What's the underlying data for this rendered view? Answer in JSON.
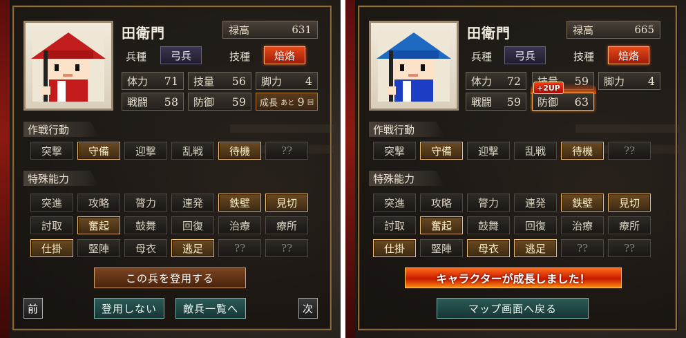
{
  "colors": {
    "frame": "#8a6a3a",
    "active_button": "#f0c070",
    "teal_button": "#2c5a56",
    "fire": "#e24a1a"
  },
  "left": {
    "name": "田衛門",
    "stipend": {
      "label": "禄高",
      "value": "631"
    },
    "unit_type": {
      "label": "兵種",
      "value": "弓兵"
    },
    "skill": {
      "label": "技種",
      "value": "焙烙"
    },
    "stats": {
      "hp": {
        "label": "体力",
        "value": "71"
      },
      "tech": {
        "label": "技量",
        "value": "56"
      },
      "legs": {
        "label": "脚力",
        "value": "4"
      },
      "combat": {
        "label": "戦闘",
        "value": "58"
      },
      "defense": {
        "label": "防御",
        "value": "59"
      }
    },
    "growth": {
      "label": "成長",
      "prefix": "あと",
      "value": "9",
      "suffix": "回"
    },
    "tactics_title": "作戦行動",
    "tactics": [
      "突撃",
      "守備",
      "迎撃",
      "乱戦",
      "待機",
      "??"
    ],
    "abilities_title": "特殊能力",
    "abilities": [
      "突進",
      "攻略",
      "膂力",
      "連発",
      "鉄壁",
      "見切",
      "討取",
      "奮起",
      "鼓舞",
      "回復",
      "治療",
      "療所",
      "仕掛",
      "堅陣",
      "母衣",
      "逃足",
      "??",
      "??"
    ],
    "recruit_button": "この兵を登用する",
    "skip_button": "登用しない",
    "enemy_list_button": "敵兵一覧へ",
    "prev_button": "前",
    "next_button": "次"
  },
  "right": {
    "name": "田衛門",
    "stipend": {
      "label": "禄高",
      "value": "665"
    },
    "unit_type": {
      "label": "兵種",
      "value": "弓兵"
    },
    "skill": {
      "label": "技種",
      "value": "焙烙"
    },
    "stats": {
      "hp": {
        "label": "体力",
        "value": "72"
      },
      "tech": {
        "label": "技量",
        "value": "59"
      },
      "legs": {
        "label": "脚力",
        "value": "4"
      },
      "combat": {
        "label": "戦闘",
        "value": "59"
      },
      "defense": {
        "label": "防御",
        "value": "63"
      }
    },
    "up_badge": "+2UP",
    "tactics_title": "作戦行動",
    "tactics": [
      "突撃",
      "守備",
      "迎撃",
      "乱戦",
      "待機",
      "??"
    ],
    "abilities_title": "特殊能力",
    "abilities": [
      "突進",
      "攻略",
      "膂力",
      "連発",
      "鉄壁",
      "見切",
      "討取",
      "奮起",
      "鼓舞",
      "回復",
      "治療",
      "療所",
      "仕掛",
      "堅陣",
      "母衣",
      "逃足",
      "??",
      "??"
    ],
    "grown_banner": "キャラクターが成長しました！",
    "back_button": "マップ画面へ戻る"
  }
}
